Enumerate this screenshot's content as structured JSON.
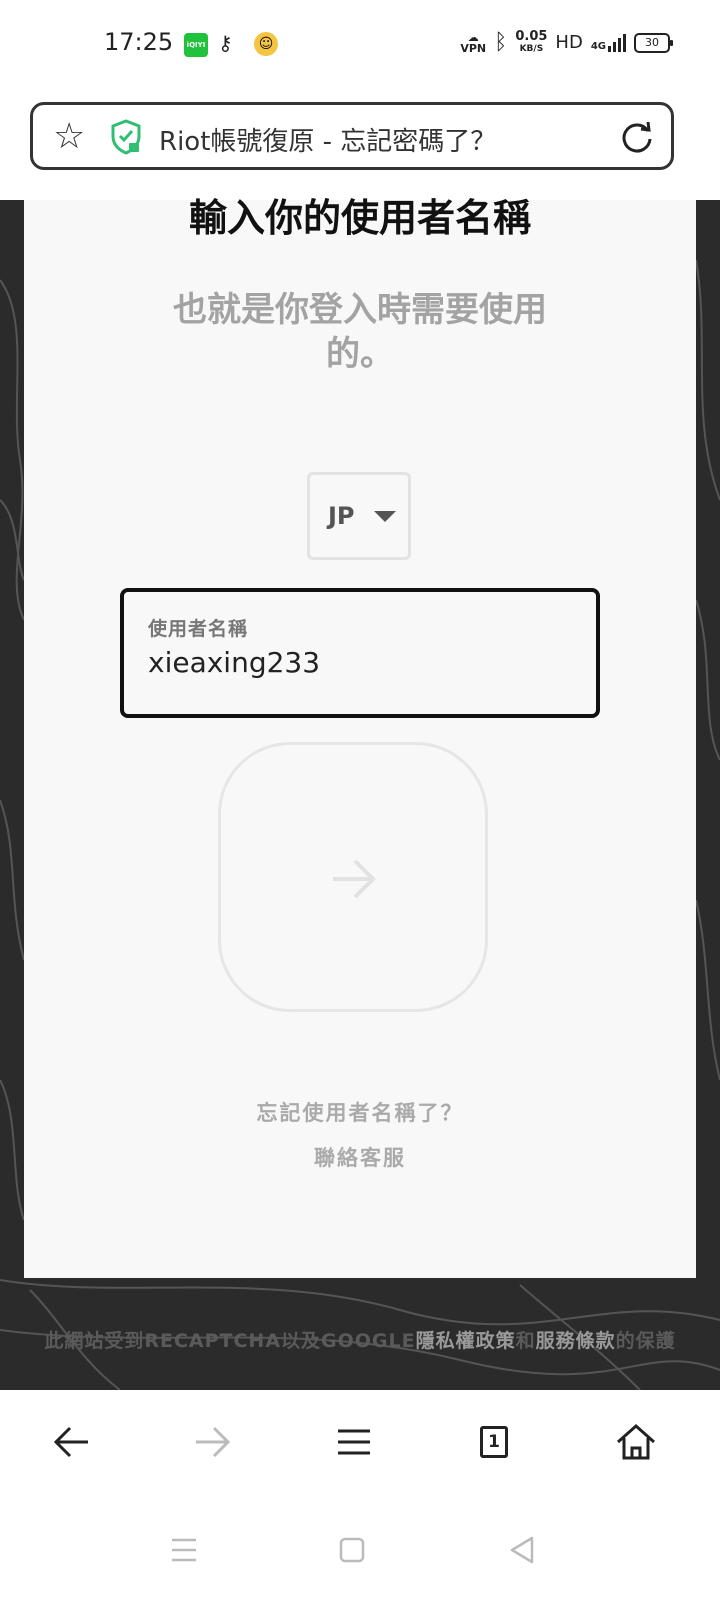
{
  "status_bar": {
    "time": "17:25",
    "app1_label": "iQIYI",
    "vpn_label": "VPN",
    "speed_value": "0.05",
    "speed_unit": "KB/S",
    "hd_label": "HD",
    "network_label": "4G",
    "battery_level": "30"
  },
  "address_bar": {
    "page_title": "Riot帳號復原 - 忘記密碼了？"
  },
  "card": {
    "heading": "輸入你的使用者名稱",
    "subtitle": "也就是你登入時需要使用的。",
    "region_selected": "JP",
    "username_label": "使用者名稱",
    "username_value": "xieaxing233",
    "forgot_username_link": "忘記使用者名稱了？",
    "contact_support_link": "聯絡客服"
  },
  "footer": {
    "part1": "此網站受到RECAPTCHA以及GOOGLE",
    "privacy_link": "隱私權政策",
    "part2": "和",
    "terms_link": "服務條款",
    "part3": "的保護"
  },
  "toolbar": {
    "tab_count": "1"
  },
  "colors": {
    "card_bg": "#f8f8f8",
    "page_bg": "#2b2b2b",
    "shield_green": "#2fbf71"
  }
}
